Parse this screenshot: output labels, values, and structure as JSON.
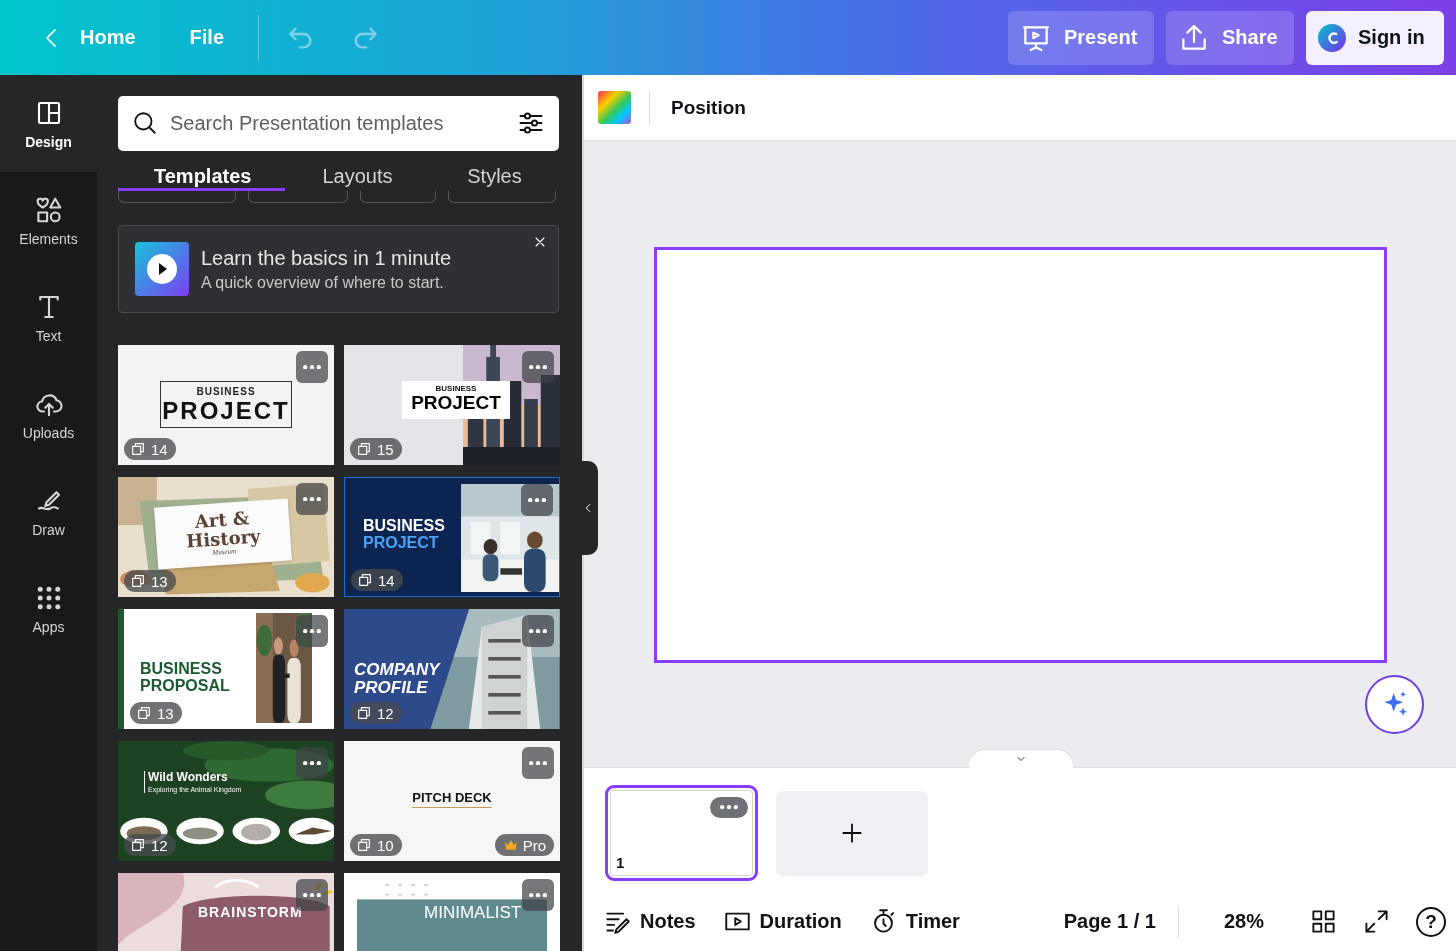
{
  "topbar": {
    "back": {
      "label": "Home"
    },
    "menu": [
      {
        "label": "File"
      }
    ],
    "history": [
      {
        "kind": "undo",
        "disabled": true
      },
      {
        "kind": "redo",
        "disabled": true
      }
    ],
    "actions": [
      {
        "kind": "present",
        "label": "Present"
      },
      {
        "kind": "share",
        "label": "Share"
      },
      {
        "kind": "signin",
        "label": "Sign in"
      }
    ]
  },
  "rail": [
    {
      "kind": "design",
      "label": "Design",
      "selected": true
    },
    {
      "kind": "elements",
      "label": "Elements",
      "selected": false
    },
    {
      "kind": "text",
      "label": "Text",
      "selected": false
    },
    {
      "kind": "uploads",
      "label": "Uploads",
      "selected": false
    },
    {
      "kind": "draw",
      "label": "Draw",
      "selected": false
    },
    {
      "kind": "apps",
      "label": "Apps",
      "selected": false
    }
  ],
  "search": {
    "placeholder": "Search Presentation templates"
  },
  "tabs": [
    {
      "label": "Templates",
      "selected": true
    },
    {
      "label": "Layouts",
      "selected": false
    },
    {
      "label": "Styles",
      "selected": false
    }
  ],
  "promo": {
    "title": "Learn the basics in 1 minute",
    "subtitle": "A quick overview of where to start."
  },
  "templates": [
    {
      "kind": "boxed",
      "lines": [
        "BUSINESS",
        "PROJECT"
      ],
      "count": "14",
      "pro": false
    },
    {
      "kind": "city",
      "lines": [
        "BUSINESS",
        "PROJECT"
      ],
      "count": "15",
      "pro": false
    },
    {
      "kind": "collage",
      "lines": [
        "Art &",
        "History",
        "Museum"
      ],
      "count": "13",
      "pro": false
    },
    {
      "kind": "navy",
      "lines": [
        "BUSINESS",
        "PROJECT"
      ],
      "count": "14",
      "pro": false
    },
    {
      "kind": "proposal",
      "lines": [
        "BUSINESS",
        "PROPOSAL"
      ],
      "count": "13",
      "pro": false
    },
    {
      "kind": "profile",
      "lines": [
        "COMPANY",
        "PROFILE"
      ],
      "count": "12",
      "pro": false
    },
    {
      "kind": "jungle",
      "lines": [
        "Wild Wonders",
        "Exploring the Animal Kingdom"
      ],
      "count": "12",
      "pro": false
    },
    {
      "kind": "pitch",
      "lines": [
        "PITCH DECK"
      ],
      "count": "10",
      "pro": true,
      "pro_label": "Pro"
    },
    {
      "kind": "brainstorm",
      "lines": [
        "BRAINSTORM"
      ],
      "pro": false
    },
    {
      "kind": "minimalist",
      "lines": [
        "MINIMALIST"
      ],
      "pro": false
    }
  ],
  "toolbar": {
    "label": "Position"
  },
  "pages": [
    {
      "number": "1",
      "selected": true
    }
  ],
  "footer": {
    "tools": [
      {
        "kind": "notes",
        "label": "Notes"
      },
      {
        "kind": "duration",
        "label": "Duration"
      },
      {
        "kind": "timer",
        "label": "Timer"
      }
    ],
    "page": "Page 1 / 1",
    "zoom": "28%",
    "help": "?"
  }
}
